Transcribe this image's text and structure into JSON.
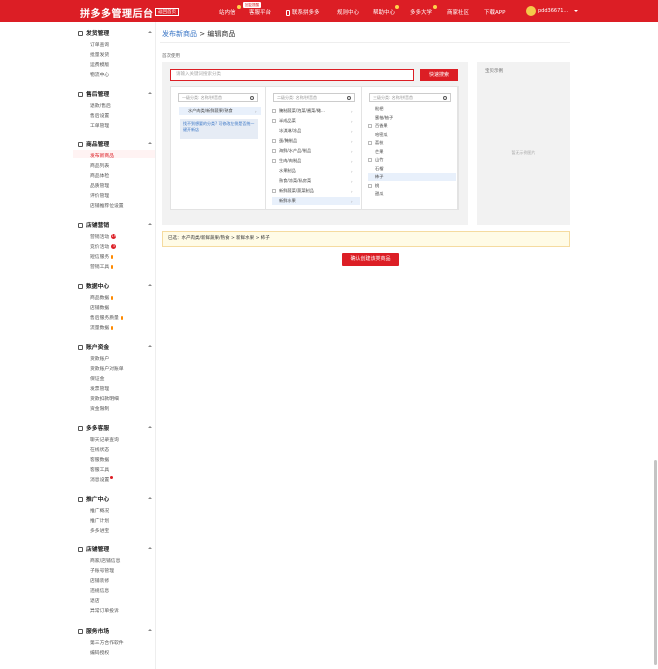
{
  "topbar": {
    "logo": "拼多多管理后台",
    "logo_badge": "返回首页",
    "nav": [
      {
        "label": "站内信",
        "dot": true
      },
      {
        "label": "客服平台",
        "dot": false
      },
      {
        "label": "联系拼多多",
        "dot": false
      },
      {
        "label": "规则中心",
        "dot": false
      },
      {
        "label": "帮助中心",
        "dot": true
      },
      {
        "label": "多多大学",
        "dot": true
      },
      {
        "label": "商家社区",
        "dot": false
      },
      {
        "label": "下载APP",
        "dot": false
      }
    ],
    "tip": "回复提醒",
    "user": "pdd36671..."
  },
  "sidebar": [
    {
      "title": "发货管理",
      "items": [
        "订单查询",
        "批量发货",
        "运费模版",
        "物流中心"
      ]
    },
    {
      "title": "售后管理",
      "items": [
        "退款/售后",
        "售后设置",
        "工单管理"
      ]
    },
    {
      "title": "商品管理",
      "items": [
        "发布新商品",
        "商品列表",
        "商品体检",
        "品质管理",
        "评价管理",
        "店铺推荐位设置"
      ]
    },
    {
      "title": "店铺营销",
      "items": [
        "营销活动",
        "竞价活动",
        "短信服务",
        "营销工具"
      ]
    },
    {
      "title": "数据中心",
      "items": [
        "商品数据",
        "店铺数据",
        "售后服务质量",
        "流量数据"
      ]
    },
    {
      "title": "账户资金",
      "items": [
        "货款账户",
        "货款账户对账单",
        "保证金",
        "发票管理",
        "货款扣款明细",
        "资金限制"
      ]
    },
    {
      "title": "多多客服",
      "items": [
        "聊天记录查询",
        "在线状态",
        "客服数据",
        "客服工具",
        "消息设置"
      ]
    },
    {
      "title": "推广中心",
      "items": [
        "推广概况",
        "推广计划",
        "多多进宝"
      ]
    },
    {
      "title": "店铺管理",
      "items": [
        "商家/店铺信息",
        "子账号管理",
        "店铺装修",
        "违规信息",
        "退店",
        "异常订单投诉"
      ]
    },
    {
      "title": "服务市场",
      "items": [
        "第三方合作软件",
        "编码授权"
      ]
    }
  ],
  "badges": {
    "营销活动": "19",
    "竞价活动": "3"
  },
  "breadcrumb": {
    "link": "发布新商品",
    "sep": ">",
    "current": "编辑商品"
  },
  "category": {
    "label": "首次使用",
    "search_placeholder": "请输入关键词搜索分类",
    "search_button": "快速搜索",
    "col1_placeholder": "一级分类: 名称/拼音首",
    "col2_placeholder": "二级分类: 名称/拼音首",
    "col3_placeholder": "三级分类: 名称/拼音首",
    "col1_items": [
      "水产肉类/新鲜蔬果/熟食"
    ],
    "col1_tip": "找不到想要的分类? 可修改左侧是否统一键开新店",
    "col2_items": [
      "腌制蔬菜/泡菜/酱菜/橄...",
      "半成品菜",
      "冰淇淋/冻品",
      "蛋/腌制品",
      "海鲜/水产品/制品",
      "生肉/肉制品",
      "水果制品",
      "熟食/凉菜/私房菜",
      "新鲜蔬菜/蔬菜制品",
      "新鲜水果"
    ],
    "col3_items": [
      "枇杷",
      "蜜柚/柚子",
      "百香果",
      "哈密瓜",
      "荔枝",
      "芒果",
      "山竹",
      "石榴",
      "柿子",
      "桃",
      "甜瓜"
    ],
    "sample_title": "宝贝示例",
    "sample_empty": "暂无示例图片"
  },
  "selected": "已选：水产肉类/新鲜蔬果/熟食 > 新鲜水果 > 柿子",
  "confirm_button": "确认创建该类商品"
}
